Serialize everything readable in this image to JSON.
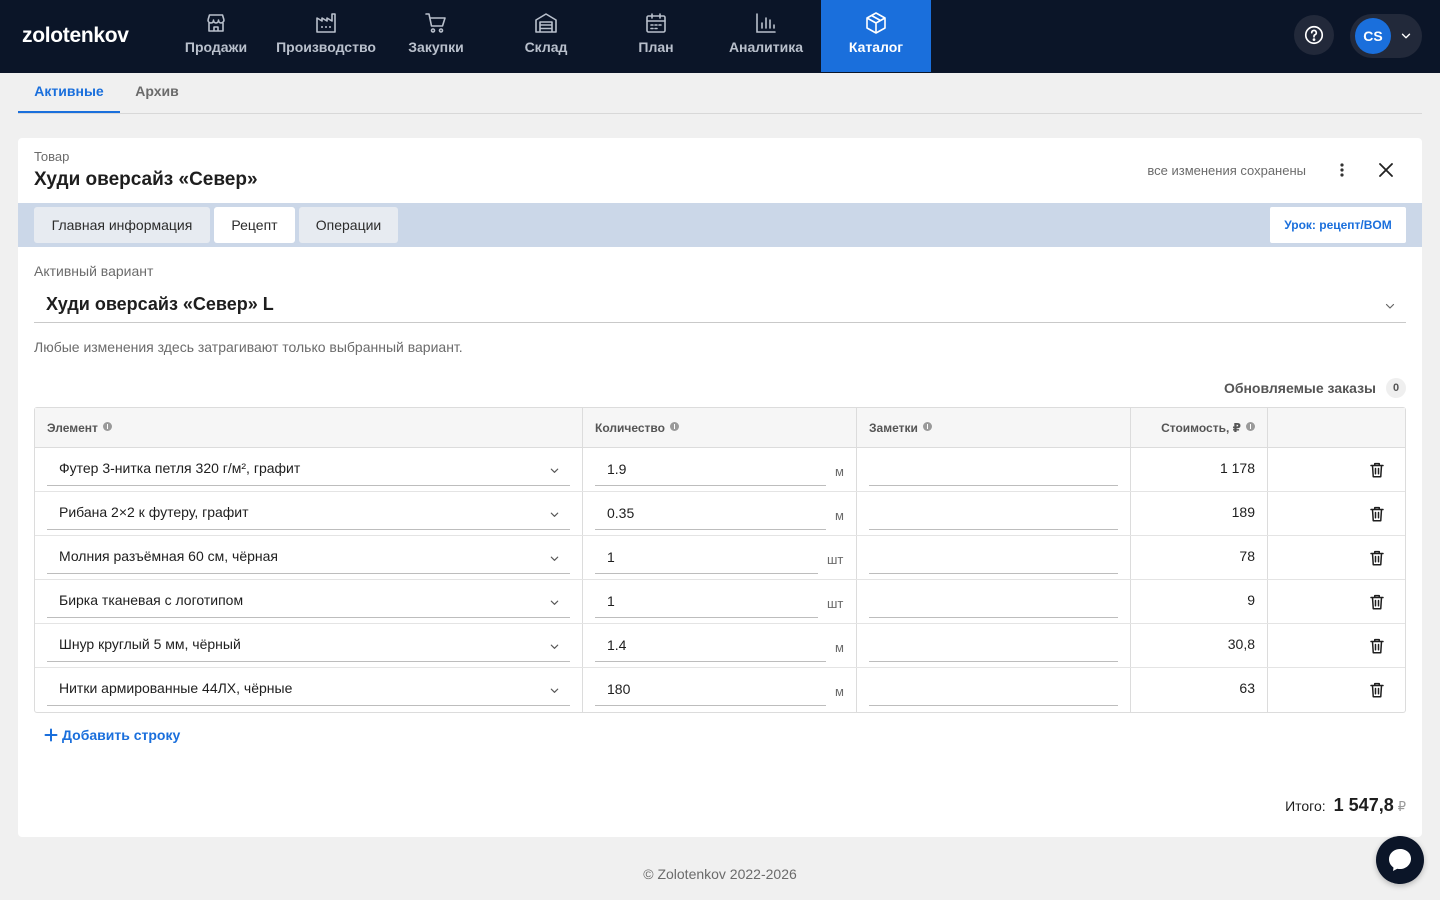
{
  "app": {
    "logo": "zolotenkov"
  },
  "nav": {
    "items": [
      {
        "label": "Продажи",
        "icon": "store-icon"
      },
      {
        "label": "Производство",
        "icon": "factory-icon"
      },
      {
        "label": "Закупки",
        "icon": "cart-icon"
      },
      {
        "label": "Склад",
        "icon": "warehouse-icon"
      },
      {
        "label": "План",
        "icon": "calendar-icon"
      },
      {
        "label": "Аналитика",
        "icon": "bar-chart-icon"
      },
      {
        "label": "Каталог",
        "icon": "box-icon",
        "active": true
      }
    ],
    "user_initials": "CS"
  },
  "subtabs": {
    "active": "Активные",
    "archive": "Архив"
  },
  "product": {
    "crumb": "Товар",
    "title": "Худи оверсайз «Север»",
    "save_status": "все изменения сохранены"
  },
  "tabs": {
    "items": [
      "Главная информация",
      "Рецепт",
      "Операции"
    ],
    "active_index": 1,
    "lesson_button": "Урок: рецепт/BOM"
  },
  "variant": {
    "label": "Активный вариант",
    "value": "Худи оверсайз «Север» L",
    "hint": "Любые изменения здесь затрагивают только выбранный вариант."
  },
  "orders": {
    "label": "Обновляемые заказы",
    "count": "0"
  },
  "table": {
    "headers": {
      "element": "Элемент",
      "quantity": "Количество",
      "notes": "Заметки",
      "cost": "Стоимость, ₽"
    },
    "rows": [
      {
        "element": "Футер 3-нитка петля 320 г/м², графит",
        "quantity": "1.9",
        "unit": "м",
        "notes": "",
        "cost": "1 178"
      },
      {
        "element": "Рибана 2×2 к футеру, графит",
        "quantity": "0.35",
        "unit": "м",
        "notes": "",
        "cost": "189"
      },
      {
        "element": "Молния разъёмная 60 см, чёрная",
        "quantity": "1",
        "unit": "шт",
        "notes": "",
        "cost": "78"
      },
      {
        "element": "Бирка тканевая с логотипом",
        "quantity": "1",
        "unit": "шт",
        "notes": "",
        "cost": "9"
      },
      {
        "element": "Шнур круглый 5 мм, чёрный",
        "quantity": "1.4",
        "unit": "м",
        "notes": "",
        "cost": "30,8"
      },
      {
        "element": "Нитки армированные 44ЛХ, чёрные",
        "quantity": "180",
        "unit": "м",
        "notes": "",
        "cost": "63"
      }
    ],
    "add_row": "Добавить строку"
  },
  "total": {
    "label": "Итого:",
    "value": "1 547,8",
    "currency": "₽"
  },
  "footer": {
    "copyright": "© Zolotenkov 2022-2026"
  },
  "colors": {
    "nav_bg": "#0b1528",
    "accent": "#1a6fdc",
    "tabbar_bg": "#cbd7e8"
  }
}
